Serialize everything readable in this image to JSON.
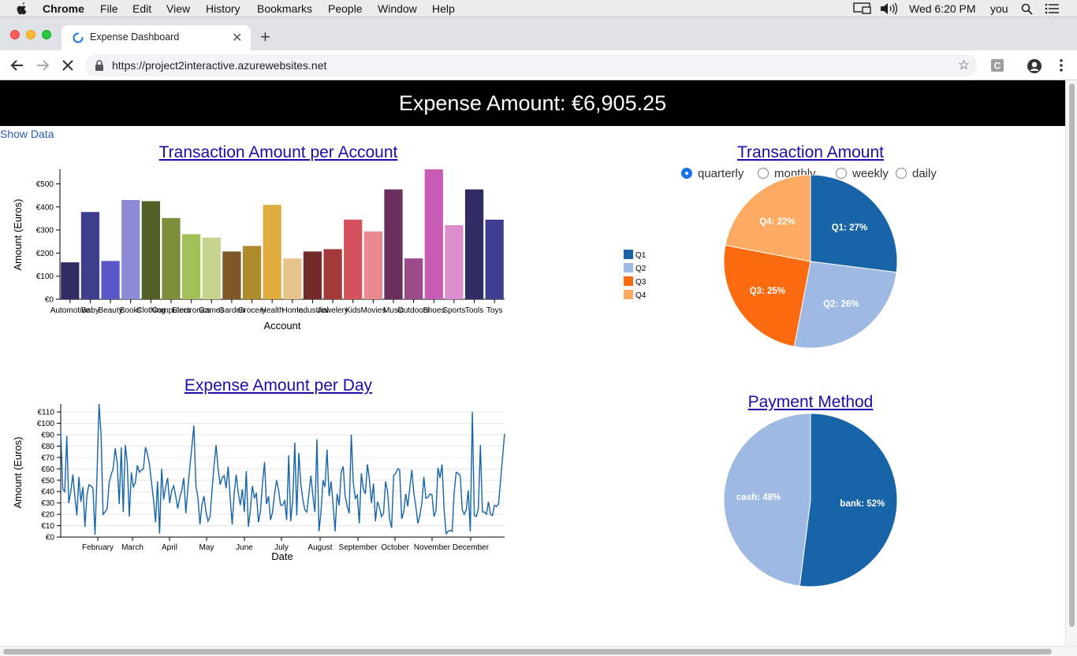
{
  "menubar": {
    "items": [
      "Chrome",
      "File",
      "Edit",
      "View",
      "History",
      "Bookmarks",
      "People",
      "Window",
      "Help"
    ],
    "clock": "Wed 6:20 PM",
    "user": "you"
  },
  "browser": {
    "tab_title": "Expense Dashboard",
    "url": "https://project2interactive.azurewebsites.net"
  },
  "page": {
    "header": "Expense Amount: €6,905.25",
    "show_data": "Show Data",
    "bar_title": "Transaction Amount per Account",
    "line_title": "Expense Amount per Day",
    "pie_title": "Transaction Amount",
    "payment_title": "Payment Method",
    "radio_options": [
      "quarterly",
      "monthly",
      "weekly",
      "daily"
    ],
    "radio_selected": "quarterly"
  },
  "chart_data": [
    {
      "type": "bar",
      "title": "Transaction Amount per Account",
      "xlabel": "Account",
      "ylabel": "Amount (Euros)",
      "categories": [
        "Automotive",
        "Baby",
        "Beauty",
        "Books",
        "Clothing",
        "Computers",
        "Electronics",
        "Games",
        "Garden",
        "Grocery",
        "Health",
        "Home",
        "Industrial",
        "Jewelery",
        "Kids",
        "Movies",
        "Music",
        "Outdoors",
        "Shoes",
        "Sports",
        "Tools",
        "Toys"
      ],
      "values": [
        160,
        378,
        166,
        430,
        425,
        352,
        282,
        267,
        207,
        231,
        409,
        177,
        207,
        217,
        345,
        294,
        476,
        177,
        563,
        321,
        476,
        345
      ],
      "colors": [
        "#2f2c63",
        "#3f3d8d",
        "#5a57c8",
        "#8e8bd6",
        "#4f6127",
        "#7b8f3b",
        "#a3bf57",
        "#c7d48d",
        "#7d5a25",
        "#ad8b2b",
        "#e0ab3f",
        "#e6c48c",
        "#712929",
        "#a33a3a",
        "#d4525c",
        "#e88a8f",
        "#6b2f5d",
        "#9b4a8a",
        "#c75cb5",
        "#dc8fcf",
        "#2f2c63",
        "#3f3d8d"
      ],
      "ylim": [
        0,
        563
      ],
      "yticks": [
        "€0",
        "€100",
        "€200",
        "€300",
        "€400",
        "€500"
      ]
    },
    {
      "type": "line",
      "title": "Expense Amount per Day",
      "xlabel": "Date",
      "ylabel": "Amount (Euros)",
      "x_ticks": [
        "February",
        "March",
        "April",
        "May",
        "June",
        "July",
        "August",
        "September",
        "October",
        "November",
        "December"
      ],
      "yticks": [
        "€0",
        "€10",
        "€20",
        "€30",
        "€40",
        "€50",
        "€60",
        "€70",
        "€80",
        "€90",
        "€100",
        "€110"
      ],
      "ylim": [
        0,
        117
      ],
      "values": [
        93,
        42,
        40,
        89,
        30,
        40,
        55,
        36,
        19,
        53,
        31,
        44,
        9,
        37,
        46,
        45,
        43,
        2,
        56,
        117,
        90,
        20,
        22,
        25,
        48,
        55,
        60,
        78,
        65,
        29,
        79,
        22,
        81,
        65,
        18,
        57,
        44,
        48,
        63,
        57,
        59,
        60,
        79,
        73,
        64,
        48,
        33,
        13,
        49,
        3,
        60,
        33,
        44,
        52,
        30,
        41,
        45,
        36,
        25,
        35,
        41,
        52,
        21,
        42,
        62,
        79,
        98,
        45,
        35,
        11,
        28,
        36,
        22,
        14,
        18,
        41,
        63,
        81,
        60,
        46,
        52,
        54,
        43,
        62,
        34,
        11,
        39,
        55,
        39,
        28,
        42,
        22,
        58,
        9,
        24,
        45,
        34,
        39,
        13,
        23,
        47,
        66,
        29,
        36,
        15,
        22,
        38,
        50,
        41,
        28,
        28,
        32,
        15,
        72,
        14,
        32,
        83,
        19,
        74,
        47,
        33,
        24,
        22,
        38,
        54,
        36,
        22,
        86,
        5,
        22,
        50,
        44,
        77,
        36,
        49,
        28,
        5,
        38,
        28,
        57,
        62,
        36,
        27,
        21,
        90,
        48,
        34,
        37,
        12,
        56,
        42,
        38,
        64,
        51,
        30,
        47,
        14,
        31,
        26,
        18,
        21,
        49,
        40,
        16,
        8,
        54,
        56,
        60,
        59,
        16,
        22,
        38,
        27,
        43,
        59,
        39,
        27,
        12,
        19,
        30,
        53,
        34,
        35,
        38,
        37,
        18,
        23,
        61,
        52,
        64,
        25,
        3,
        5,
        6,
        5,
        39,
        57,
        56,
        54,
        24,
        20,
        24,
        41,
        5,
        110,
        19,
        18,
        25,
        81,
        22,
        22,
        20,
        31,
        20,
        19,
        28,
        27,
        29,
        50,
        70,
        91
      ]
    },
    {
      "type": "pie",
      "title": "Transaction Amount",
      "labels": [
        "Q1",
        "Q2",
        "Q3",
        "Q4"
      ],
      "values": [
        27,
        26,
        25,
        22
      ],
      "slice_labels": [
        "Q1: 27%",
        "Q2: 26%",
        "Q3: 25%",
        "Q4: 22%"
      ],
      "colors": [
        "#1764a9",
        "#9ebae2",
        "#fd6b10",
        "#fdab62"
      ]
    },
    {
      "type": "pie",
      "title": "Payment Method",
      "labels": [
        "bank",
        "cash"
      ],
      "values": [
        52,
        48
      ],
      "slice_labels": [
        "bank: 52%",
        "cash: 48%"
      ],
      "colors": [
        "#1764a9",
        "#9ebae2"
      ]
    }
  ]
}
